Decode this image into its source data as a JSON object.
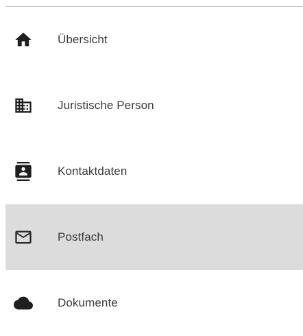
{
  "nav": {
    "items": [
      {
        "label": "Übersicht",
        "icon": "home-icon",
        "active": false
      },
      {
        "label": "Juristische Person",
        "icon": "business-icon",
        "active": false
      },
      {
        "label": "Kontaktdaten",
        "icon": "contact-card-icon",
        "active": false
      },
      {
        "label": "Postfach",
        "icon": "mail-icon",
        "active": true
      },
      {
        "label": "Dokumente",
        "icon": "cloud-icon",
        "active": false
      }
    ]
  },
  "colors": {
    "active_background": "#dcdcdc",
    "icon": "#1f1f1f",
    "label": "#3a3a3a",
    "divider": "#c8c8c8"
  }
}
